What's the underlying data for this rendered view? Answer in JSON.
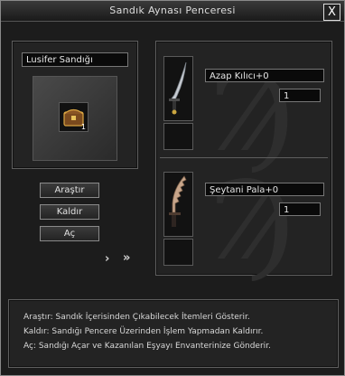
{
  "window": {
    "title": "Sandık Aynası Penceresi",
    "close_label": "X"
  },
  "chest": {
    "name": "Lusifer Sandığı",
    "count": "1"
  },
  "buttons": {
    "search": "Araştır",
    "remove": "Kaldır",
    "open": "Aç"
  },
  "nav": {
    "next": "›",
    "next_double": "»"
  },
  "items": [
    {
      "name": "Azap Kılıcı+0",
      "qty": "1"
    },
    {
      "name": "Şeytani Pala+0",
      "qty": "1"
    }
  ],
  "info": [
    "Araştır: Sandık İçerisinden Çıkabilecek İtemleri Gösterir.",
    "Kaldır: Sandığı Pencere Üzerinden İşlem Yapmadan Kaldırır.",
    "Aç: Sandığı Açar ve Kazanılan Eşyayı Envanterinize Gönderir."
  ],
  "colors": {
    "background": "#1c1c1c",
    "border": "#8a8a8a",
    "text": "#dcdcdc"
  }
}
